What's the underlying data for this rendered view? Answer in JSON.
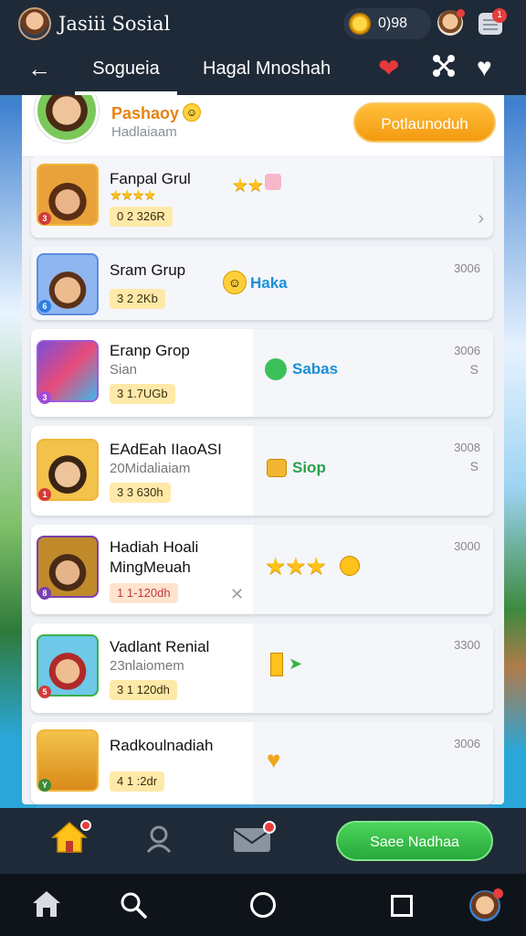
{
  "header": {
    "app_title": "Jasiii Sosial",
    "coin_count": "0)98",
    "notification_badge": "1"
  },
  "nav": {
    "tabs": [
      {
        "label": "Sogueia"
      },
      {
        "label": "Hagal Mnoshah"
      }
    ]
  },
  "profile": {
    "name": "Pashaoy",
    "subtitle": "Hadlaiaam",
    "button_label": "Potlaunoduh"
  },
  "rows": [
    {
      "title": "Fanpal Grul",
      "sub": "",
      "tag": "0 2 326R",
      "status": "",
      "value": "",
      "value2": ""
    },
    {
      "title": "Sram Grup",
      "sub": "",
      "tag": "3 2 2Kb",
      "status": "Haka",
      "value": "3006",
      "value2": ""
    },
    {
      "title": "Eranp Grop",
      "sub": "Sian",
      "tag": "3 1.7UGb",
      "status": "Sabas",
      "value": "3006",
      "value2": "S"
    },
    {
      "title": "EAdEah IIaoASI",
      "sub": "20Midaliaiam",
      "tag": "3 3 630h",
      "status": "Siop",
      "value": "3008",
      "value2": "S"
    },
    {
      "title": "Hadiah Hoali MingMeuah",
      "sub": "",
      "tag": "1 1-120dh",
      "status": "",
      "value": "3000",
      "value2": ""
    },
    {
      "title": "Vadlant Renial",
      "sub": "23nlaiomem",
      "tag": "3 1 120dh",
      "status": "",
      "value": "3300",
      "value2": ""
    },
    {
      "title": "Radkoulnadiah",
      "sub": "",
      "tag": "4 1 :2dr",
      "status": "",
      "value": "3006",
      "value2": ""
    }
  ],
  "actions": {
    "save_label": "Saee Nadhaa"
  },
  "colors": {
    "accent_orange": "#f49a10",
    "accent_green": "#28a83a",
    "bar_dark": "#1f2a38",
    "status_blue": "#1a8fd6",
    "status_green": "#2aa14a"
  },
  "icons": [
    "back-arrow-icon",
    "heart-icon",
    "share-icon",
    "home-icon",
    "chat-icon",
    "mail-icon",
    "search-icon"
  ]
}
